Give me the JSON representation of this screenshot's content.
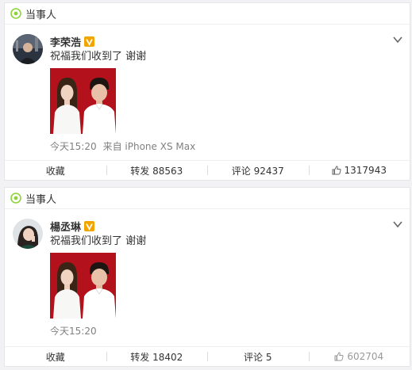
{
  "posts": [
    {
      "tag_label": "当事人",
      "user_name": "李荣浩",
      "text": "祝福我们收到了 谢谢",
      "time": "今天15:20",
      "source": "来自 iPhone XS Max",
      "actions": {
        "favorite_label": "收藏",
        "repost_label": "转发 88563",
        "comment_label": "评论 92437",
        "like_count": "1317943"
      }
    },
    {
      "tag_label": "当事人",
      "user_name": "楊丞琳",
      "text": "祝福我们收到了 谢谢",
      "time": "今天15:20",
      "actions": {
        "favorite_label": "收藏",
        "repost_label": "转发 18402",
        "comment_label": "评论 5",
        "like_count": "602704"
      }
    }
  ],
  "colors": {
    "tag_icon": "#8ed33b",
    "verified_badge": "#f2a500",
    "photo_background": "#b3121c"
  },
  "icons": {
    "tag": "circle-tag-icon",
    "verified": "verified-v-badge-icon",
    "menu": "chevron-down-icon",
    "like": "thumbs-up-icon"
  }
}
